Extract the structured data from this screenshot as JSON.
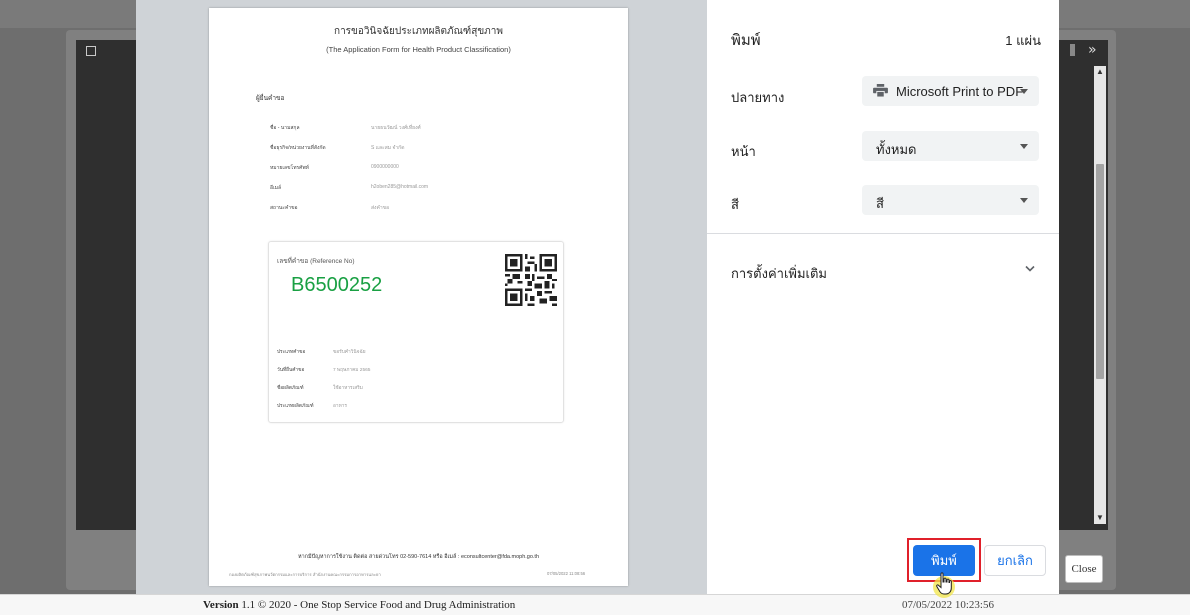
{
  "preview": {
    "title": "การขอวินิจฉัยประเภทผลิตภัณฑ์สุขภาพ",
    "subtitle": "(The Application Form for Health Product Classification)",
    "applicant_heading": "ผู้ยื่นคำขอ",
    "applicant_fields": [
      {
        "label": "ชื่อ - นามสกุล",
        "value": "นายธนวัฒน์ วงศ์เที่ยงศ์"
      },
      {
        "label": "ชื่อธุรกิจ/หน่วยงานที่สังกัด",
        "value": "S และสม จำกัด"
      },
      {
        "label": "หมายเลขโทรศัพท์",
        "value": "0900000000"
      },
      {
        "label": "อีเมล์",
        "value": "h2oben285@hotmail.com"
      },
      {
        "label": "สถานะคำขอ",
        "value": "ส่งคำขอ"
      }
    ],
    "reference_label": "เลขที่คำขอ (Reference No)",
    "reference_number": "B6500252",
    "request_fields": [
      {
        "label": "ประเภทคำขอ",
        "value": "ขอรับคำวินิจฉัย"
      },
      {
        "label": "วันที่ยื่นคำขอ",
        "value": "7 พฤษภาคม 2565"
      },
      {
        "label": "ชื่อผลิตภัณฑ์",
        "value": "ใช้อาหารเสริม"
      },
      {
        "label": "ประเภทผลิตภัณฑ์",
        "value": "อาหาร"
      }
    ],
    "contact_line": "หากมีปัญหาการใช้งาน ติดต่อ สายด่วนโทร 02-590-7614 หรือ อีเมล์ : econsultcenter@fda.moph.go.th",
    "bottom_left": "กองผลิตภัณฑ์สุขภาพนวัตกรรมและการบริการ สำนักงานคณะกรรมการอาหารและยา",
    "bottom_right": "07/05/2022 11:08:56"
  },
  "print_dialog": {
    "title": "พิมพ์",
    "sheet_count": "1 แผ่น",
    "destination_label": "ปลายทาง",
    "destination_value": "Microsoft Print to PDF",
    "pages_label": "หน้า",
    "pages_value": "ทั้งหมด",
    "color_label": "สี",
    "color_value": "สี",
    "more_settings_label": "การตั้งค่าเพิ่มเติม",
    "print_button": "พิมพ์",
    "cancel_button": "ยกเลิก"
  },
  "background_page": {
    "close_button": "Close",
    "footer_version_bold": "Version",
    "footer_text": " 1.1 © 2020 - One Stop Service Food and Drug Administration",
    "footer_datetime": "07/05/2022 10:23:56"
  },
  "colors": {
    "primary_blue": "#1a73e8",
    "reference_green": "#19a043",
    "highlight_red": "#e0202a"
  },
  "icons": {
    "printer": "printer-icon",
    "more_chevron": "chevron-down-icon",
    "cursor": "hand-cursor-icon",
    "qr": "qr-code"
  }
}
